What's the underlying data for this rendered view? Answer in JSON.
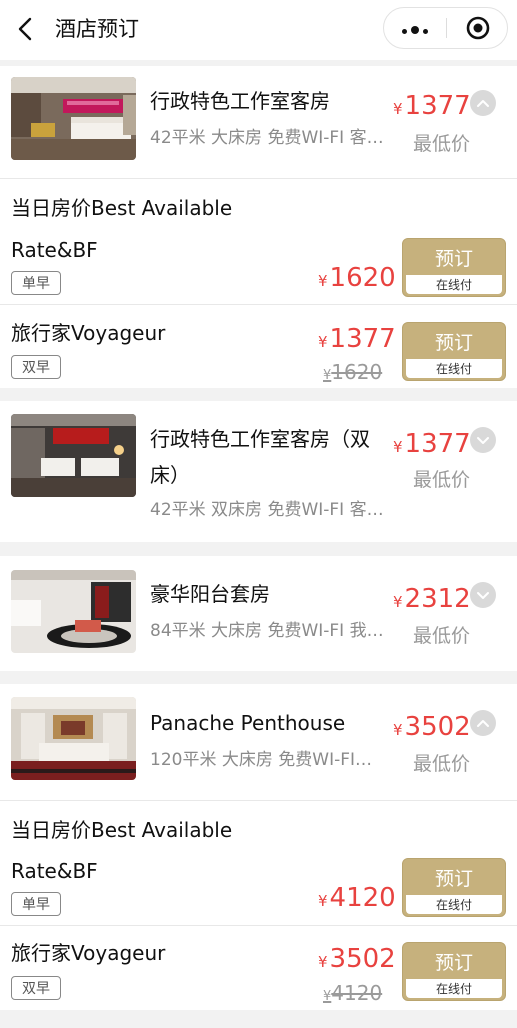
{
  "nav": {
    "title": "酒店预订",
    "back_icon": "chevron-left-icon",
    "more_icon": "more-dots-icon",
    "close_icon": "target-close-icon"
  },
  "rooms": [
    {
      "name": "行政特色工作室客房",
      "desc": "42平米 大床房 免费WI-FI 客…",
      "price_currency": "¥",
      "price": "1377",
      "price_note": "最低价",
      "expanded": true,
      "rate_group_title": "当日房价Best Available",
      "rates": [
        {
          "name": "Rate&BF",
          "badge": "单早",
          "currency": "¥",
          "price": "1620",
          "original_currency": "",
          "original_price": "",
          "book_label": "预订",
          "pay_label": "在线付"
        },
        {
          "name": "旅行家Voyageur",
          "badge": "双早",
          "currency": "¥",
          "price": "1377",
          "original_currency": "¥",
          "original_price": "1620",
          "book_label": "预订",
          "pay_label": "在线付"
        }
      ]
    },
    {
      "name": "行政特色工作室客房（双床）",
      "desc": "42平米 双床房 免费WI-FI 客…",
      "price_currency": "¥",
      "price": "1377",
      "price_note": "最低价",
      "expanded": false
    },
    {
      "name": "豪华阳台套房",
      "desc": "84平米 大床房 免费WI-FI 我…",
      "price_currency": "¥",
      "price": "2312",
      "price_note": "最低价",
      "expanded": false
    },
    {
      "name": "Panache Penthouse",
      "desc": "120平米 大床房 免费WI-FI…",
      "price_currency": "¥",
      "price": "3502",
      "price_note": "最低价",
      "expanded": true,
      "rate_group_title": "当日房价Best Available",
      "rates": [
        {
          "name": "Rate&BF",
          "badge": "单早",
          "currency": "¥",
          "price": "4120",
          "original_currency": "",
          "original_price": "",
          "book_label": "预订",
          "pay_label": "在线付"
        },
        {
          "name": "旅行家Voyageur",
          "badge": "双早",
          "currency": "¥",
          "price": "3502",
          "original_currency": "¥",
          "original_price": "4120",
          "book_label": "预订",
          "pay_label": "在线付"
        }
      ]
    }
  ],
  "colors": {
    "price": "#e8423f",
    "book_button": "#c6b17d",
    "background": "#f2f2f2"
  }
}
